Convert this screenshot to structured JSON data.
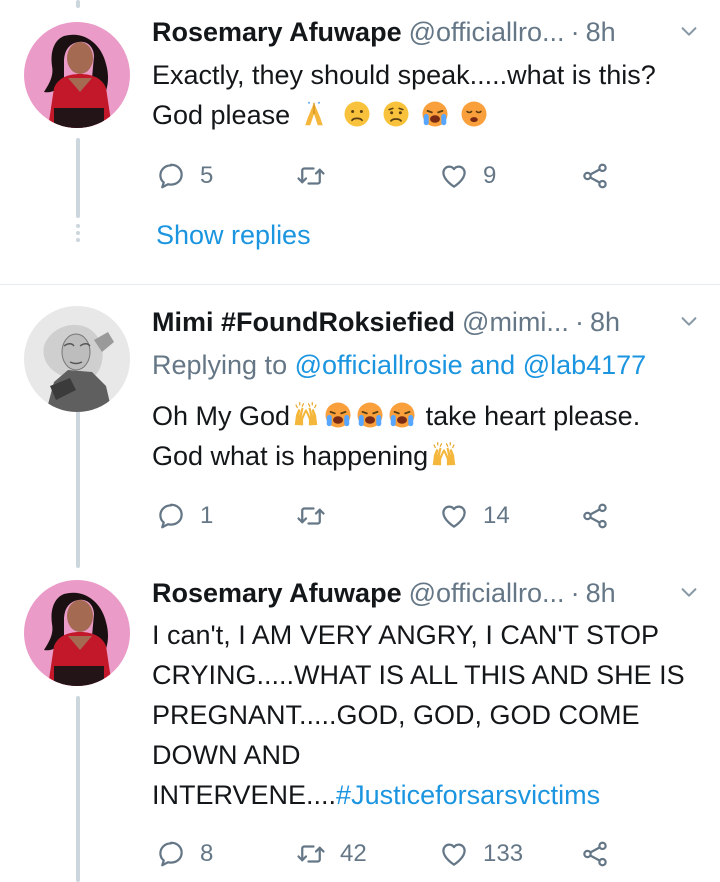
{
  "tweets": [
    {
      "name": "Rosemary Afuwape",
      "handle": "@officiallro...",
      "time": "8h",
      "text": "Exactly, they should speak.....what is this? God please",
      "emojis": [
        "folded-hands",
        "frowning-face",
        "sad-face",
        "crying-face",
        "sleepy-face"
      ],
      "replies": "5",
      "retweets": "",
      "likes": "9",
      "show_replies": "Show replies"
    },
    {
      "name": "Mimi #FoundRoksiefied",
      "handle": "@mimi...",
      "time": "8h",
      "replying_prefix": "Replying to",
      "replying_mention_1": "@officiallrosie",
      "replying_and": "and",
      "replying_mention_2": "@lab4177",
      "text_part1": "Oh My God",
      "text_part2": "take heart please.",
      "text_part3": "God what is happening",
      "replies": "1",
      "retweets": "",
      "likes": "14"
    },
    {
      "name": "Rosemary Afuwape",
      "handle": "@officiallro...",
      "time": "8h",
      "text": "I can't, I AM VERY ANGRY, I CAN'T STOP CRYING.....WHAT IS ALL THIS AND SHE IS PREGNANT.....GOD, GOD, GOD COME DOWN AND INTERVENE....",
      "hashtag": "#Justiceforsarsvictims",
      "replies": "8",
      "retweets": "42",
      "likes": "133"
    }
  ],
  "colors": {
    "link": "#1b95e0",
    "muted": "#657786",
    "text": "#14171a",
    "line": "#ccd6dd"
  }
}
